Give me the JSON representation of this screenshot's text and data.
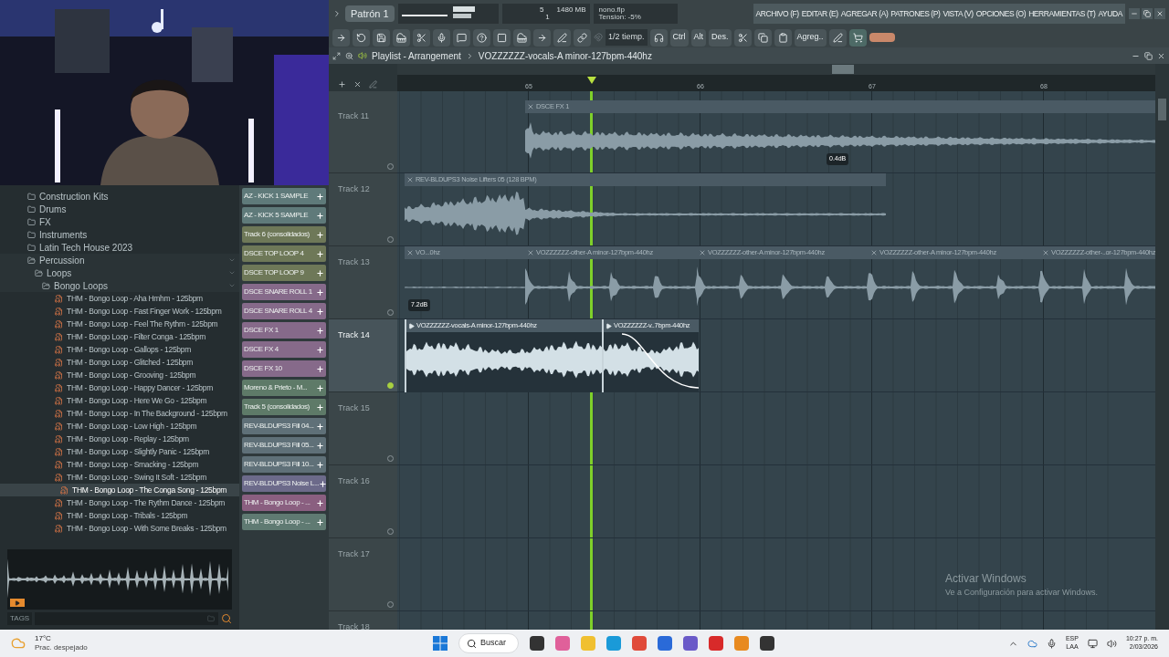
{
  "topbar": {
    "pattern": "Patrón 1",
    "stats": [
      "5",
      "1480 MB",
      "1"
    ],
    "hint": {
      "file": "nono.flp",
      "detail": "Tension: -5%"
    },
    "menu": [
      "ARCHIVO (F)",
      "EDITAR (E)",
      "AGREGAR (A)",
      "PATRONES (P)",
      "VISTA (V)",
      "OPCIONES (O)",
      "HERRAMIENTAS (T)",
      "AYUDA"
    ]
  },
  "toolbar": {
    "snap": "1/2 tiemp.",
    "keys": [
      "Ctrl",
      "Alt",
      "Des."
    ],
    "add": "Agreg.."
  },
  "browser": {
    "tree": [
      {
        "label": "Construction Kits",
        "kind": "folder",
        "expanded": false
      },
      {
        "label": "Drums",
        "kind": "folder",
        "expanded": false
      },
      {
        "label": "FX",
        "kind": "folder",
        "expanded": false
      },
      {
        "label": "Instruments",
        "kind": "folder",
        "expanded": false
      },
      {
        "label": "Latin Tech House 2023",
        "kind": "folder",
        "expanded": false
      },
      {
        "label": "Percussion",
        "kind": "folder",
        "expanded": true,
        "children": [
          {
            "label": "Loops",
            "kind": "folder",
            "expanded": true,
            "children": [
              {
                "label": "Bongo Loops",
                "kind": "folder",
                "expanded": true,
                "children": [
                  {
                    "label": "THM - Bongo Loop - Aha Hmhm - 125bpm",
                    "kind": "file",
                    "selected": false
                  },
                  {
                    "label": "THM - Bongo Loop - Fast Finger Work - 125bpm",
                    "kind": "file",
                    "selected": false
                  },
                  {
                    "label": "THM - Bongo Loop - Feel The Rythm - 125bpm",
                    "kind": "file",
                    "selected": false
                  },
                  {
                    "label": "THM - Bongo Loop - Filter Conga - 125bpm",
                    "kind": "file",
                    "selected": false
                  },
                  {
                    "label": "THM - Bongo Loop - Gallops - 125bpm",
                    "kind": "file",
                    "selected": false
                  },
                  {
                    "label": "THM - Bongo Loop - Glitched - 125bpm",
                    "kind": "file",
                    "selected": false
                  },
                  {
                    "label": "THM - Bongo Loop - Grooving - 125bpm",
                    "kind": "file",
                    "selected": false
                  },
                  {
                    "label": "THM - Bongo Loop - Happy Dancer - 125bpm",
                    "kind": "file",
                    "selected": false
                  },
                  {
                    "label": "THM - Bongo Loop - Here We Go - 125bpm",
                    "kind": "file",
                    "selected": false
                  },
                  {
                    "label": "THM - Bongo Loop - In The Background - 125bpm",
                    "kind": "file",
                    "selected": false
                  },
                  {
                    "label": "THM - Bongo Loop - Low High - 125bpm",
                    "kind": "file",
                    "selected": false
                  },
                  {
                    "label": "THM - Bongo Loop - Replay - 125bpm",
                    "kind": "file",
                    "selected": false
                  },
                  {
                    "label": "THM - Bongo Loop - Slightly Panic - 125bpm",
                    "kind": "file",
                    "selected": false
                  },
                  {
                    "label": "THM - Bongo Loop - Smacking - 125bpm",
                    "kind": "file",
                    "selected": false
                  },
                  {
                    "label": "THM - Bongo Loop - Swing It Soft - 125bpm",
                    "kind": "file",
                    "selected": false
                  },
                  {
                    "label": "THM - Bongo Loop - The Conga Song - 125bpm",
                    "kind": "file",
                    "selected": true
                  },
                  {
                    "label": "THM - Bongo Loop - The Rythm Dance - 125bpm",
                    "kind": "file",
                    "selected": false
                  },
                  {
                    "label": "THM - Bongo Loop - Tribals - 125bpm",
                    "kind": "file",
                    "selected": false
                  },
                  {
                    "label": "THM - Bongo Loop - With Some Breaks - 125bpm",
                    "kind": "file",
                    "selected": false
                  }
                ]
              }
            ]
          }
        ]
      }
    ],
    "tags_label": "TAGS"
  },
  "picker": [
    {
      "label": "AZ - KICK 1 SAMPLE",
      "color": "#5f7a7a"
    },
    {
      "label": "AZ - KICK 5 SAMPLE",
      "color": "#5f7a7a"
    },
    {
      "label": "Track 6 (consolidados)",
      "color": "#6e7858"
    },
    {
      "label": "DSCE TOP LOOP 4",
      "color": "#6e7858"
    },
    {
      "label": "DSCE TOP LOOP 9",
      "color": "#6e7858"
    },
    {
      "label": "DSCE SNARE ROLL 1",
      "color": "#866a8a"
    },
    {
      "label": "DSCE SNARE ROLL 4",
      "color": "#866a8a"
    },
    {
      "label": "DSCE FX 1",
      "color": "#866a8a"
    },
    {
      "label": "DSCE FX 4",
      "color": "#866a8a"
    },
    {
      "label": "DSCE FX 10",
      "color": "#866a8a"
    },
    {
      "label": "Moreno & Prieto - M...",
      "color": "#5e7a68"
    },
    {
      "label": "Track 5 (consolidados)",
      "color": "#5e7a68"
    },
    {
      "label": "REV-BLDUPS3 Fill 04...",
      "color": "#5f7078"
    },
    {
      "label": "REV-BLDUPS3 Fill 05...",
      "color": "#5f7078"
    },
    {
      "label": "REV-BLDUPS3 Fill 10...",
      "color": "#5f7078"
    },
    {
      "label": "REV-BLDUPS3 Noise L...",
      "color": "#6c6a8a"
    },
    {
      "label": "THM - Bongo Loop - ...",
      "color": "#8a5f80"
    },
    {
      "label": "THM - Bongo Loop - ...",
      "color": "#5f7a72"
    }
  ],
  "playlist": {
    "title": "Playlist - Arrangement",
    "current": "VOZZZZZZ-vocals-A minor-127bpm-440hz",
    "bars": [
      "65",
      "66",
      "67",
      "68"
    ],
    "tracks": [
      {
        "name": "Track 11",
        "selected": false,
        "gain_label": "0.4dB",
        "clips": [
          {
            "label": "DSCE FX 1",
            "selected": false
          }
        ]
      },
      {
        "name": "Track 12",
        "selected": false,
        "clips": [
          {
            "label": "REV-BLDUPS3 Noise Lifters 05 (128 BPM)",
            "selected": false
          }
        ]
      },
      {
        "name": "Track 13",
        "selected": false,
        "gain_label": "7.2dB",
        "clips": [
          {
            "label": "VO...0hz",
            "selected": false
          },
          {
            "label": "VOZZZZZZ-other-A minor-127bpm-440hz",
            "selected": false
          },
          {
            "label": "VOZZZZZZ-other-A minor-127bpm-440hz",
            "selected": false
          },
          {
            "label": "VOZZZZZZ-other-A minor-127bpm-440hz",
            "selected": false
          },
          {
            "label": "VOZZZZZZ-other-..or-127bpm-440hz",
            "selected": false
          }
        ]
      },
      {
        "name": "Track 14",
        "selected": true,
        "clips": [
          {
            "label": "VOZZZZZZ-vocals-A minor-127bpm-440hz",
            "selected": true
          },
          {
            "label": "VOZZZZZZ-v..7bpm-440hz",
            "selected": true
          }
        ]
      },
      {
        "name": "Track 15",
        "selected": false
      },
      {
        "name": "Track 16",
        "selected": false
      },
      {
        "name": "Track 17",
        "selected": false
      },
      {
        "name": "Track 18",
        "selected": false
      }
    ]
  },
  "activation": {
    "title": "Activar Windows",
    "detail": "Ve a Configuración para activar Windows."
  },
  "taskbar": {
    "weather": {
      "temp": "17°C",
      "condition": "Prac. despejado"
    },
    "search": "Buscar",
    "language": [
      "ESP",
      "LAA"
    ],
    "time": "10:27 p. m.",
    "date": "2/03/2026"
  }
}
